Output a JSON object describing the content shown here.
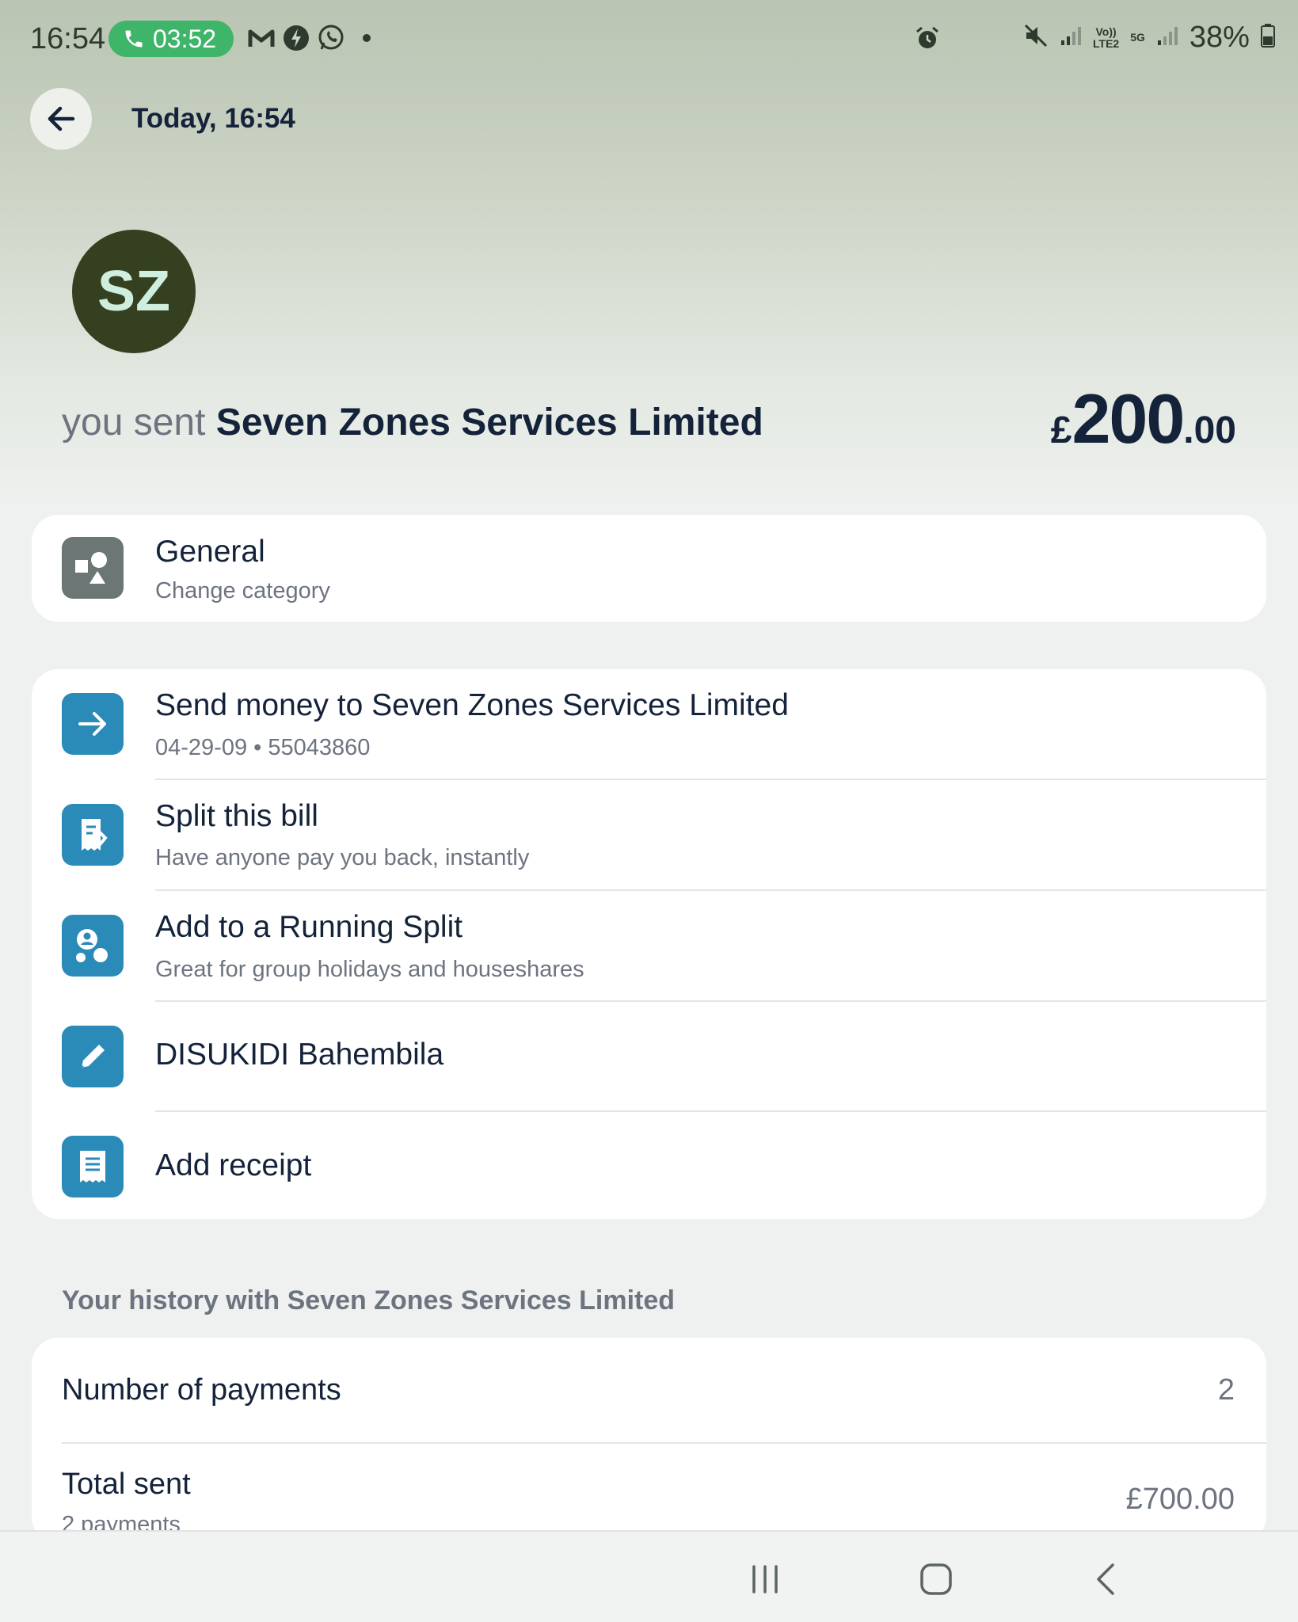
{
  "status_bar": {
    "time": "16:54",
    "call_timer": "03:52",
    "battery": "38%",
    "network_top": "Vo))",
    "network_bottom": "LTE2",
    "network_5g": "5G"
  },
  "header": {
    "title": "Today, 16:54"
  },
  "transaction": {
    "avatar_initials": "SZ",
    "sent_prefix": "you sent",
    "recipient": "Seven Zones Services Limited",
    "amount_currency": "£",
    "amount_major": "200",
    "amount_minor": ".00"
  },
  "category": {
    "title": "General",
    "subtitle": "Change category"
  },
  "actions": [
    {
      "title": "Send money to Seven Zones Services Limited",
      "subtitle": "04-29-09 • 55043860",
      "icon": "arrow-right-icon"
    },
    {
      "title": "Split this bill",
      "subtitle": "Have anyone pay you back, instantly",
      "icon": "split-bill-icon"
    },
    {
      "title": "Add to a Running Split",
      "subtitle": "Great for group holidays and houseshares",
      "icon": "group-icon"
    },
    {
      "title": "DISUKIDI Bahembila",
      "subtitle": "",
      "icon": "pencil-icon"
    },
    {
      "title": "Add receipt",
      "subtitle": "",
      "icon": "receipt-icon"
    }
  ],
  "history": {
    "label": "Your history with Seven Zones Services Limited",
    "rows": [
      {
        "title": "Number of payments",
        "value": "2"
      },
      {
        "title": "Total sent",
        "subtitle": "2 payments",
        "value": "£700.00"
      }
    ]
  },
  "colors": {
    "accent_blue": "#2a8bb8",
    "avatar_bg": "#34401f",
    "call_green": "#3fb56a"
  }
}
